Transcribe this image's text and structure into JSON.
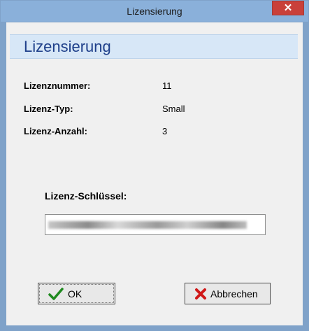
{
  "window": {
    "title": "Lizensierung",
    "close_symbol": "✕"
  },
  "header": {
    "title": "Lizensierung"
  },
  "license_info": [
    {
      "label": "Lizenznummer:",
      "value": "11"
    },
    {
      "label": "Lizenz-Typ:",
      "value": "Small"
    },
    {
      "label": "Lizenz-Anzahl:",
      "value": "3"
    }
  ],
  "license_key": {
    "label": "Lizenz-Schlüssel:"
  },
  "buttons": {
    "ok_label": "OK",
    "cancel_label": "Abbrechen"
  },
  "icons": {
    "ok": "checkmark-icon",
    "cancel": "red-x-icon"
  },
  "colors": {
    "titlebar": "#8ab0da",
    "close_button": "#c9403a",
    "header_band": "#d7e7f7",
    "header_text": "#1e3f8a",
    "ok_icon": "#1f8a1f",
    "cancel_icon": "#d01818"
  }
}
